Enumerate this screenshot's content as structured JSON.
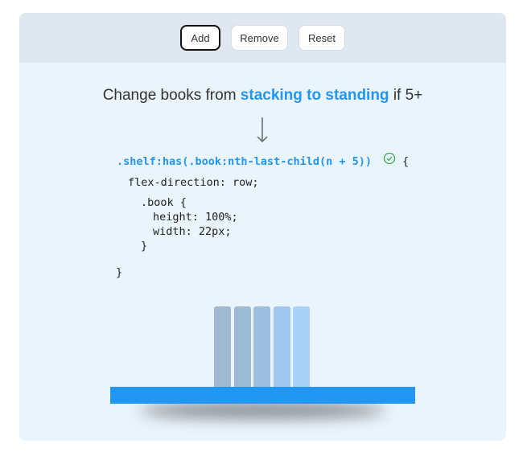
{
  "toolbar": {
    "add_label": "Add",
    "remove_label": "Remove",
    "reset_label": "Reset"
  },
  "heading": {
    "prefix": "Change books from ",
    "highlight": "stacking to standing",
    "suffix": " if 5+"
  },
  "code": {
    "selector": ".shelf:has(.book:nth-last-child(n + 5))",
    "open_brace": "{",
    "line_flex": "flex-direction: row;",
    "book_selector": ".book {",
    "line_height": "height: 100%;",
    "line_width": "width: 22px;",
    "book_close": "}",
    "close_brace": "}"
  },
  "books": [
    {
      "color": "#9fb9d0"
    },
    {
      "color": "#9ebbd6"
    },
    {
      "color": "#9ec0e0"
    },
    {
      "color": "#a0c8ec"
    },
    {
      "color": "#a8d1f6"
    }
  ],
  "colors": {
    "accent": "#2196f3",
    "card_bg": "#eaf4fc",
    "toolbar_bg": "#dfe8f1",
    "match_check": "#3bab4a"
  },
  "icons": {
    "arrow": "down-arrow-icon",
    "check": "check-circle-icon"
  }
}
